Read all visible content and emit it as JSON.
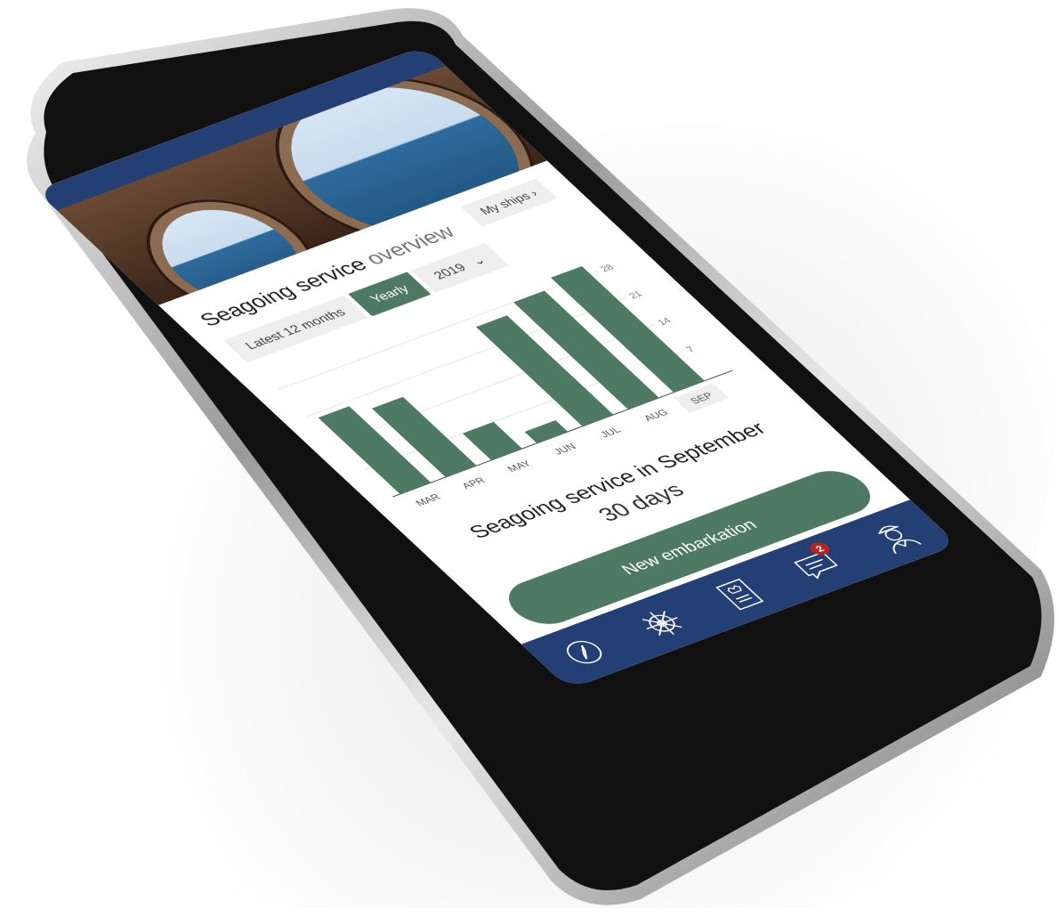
{
  "overview": {
    "title_strong": "Seagoing service",
    "title_light": "overview",
    "my_ships_label": "My ships",
    "chevron": "›"
  },
  "filters": {
    "latest_label": "Latest 12 months",
    "yearly_label": "Yearly",
    "year_value": "2019",
    "dropdown_glyph": "⌄"
  },
  "chart_data": {
    "type": "bar",
    "categories": [
      "MAR",
      "APR",
      "MAY",
      "JUN",
      "JUL",
      "AUG",
      "SEP"
    ],
    "values": [
      20,
      18,
      7,
      3,
      26,
      28,
      30
    ],
    "yticks": [
      "28",
      "21",
      "14",
      "7"
    ],
    "ylim": [
      0,
      30
    ],
    "highlight": "SEP",
    "colors": {
      "bar": "#4e7a63",
      "highlight_bg": "#eeeeee",
      "grid": "#dddddd"
    }
  },
  "summary": {
    "label": "Seagoing service in September",
    "value": "30 days"
  },
  "cta": {
    "label": "New embarkation"
  },
  "tabbar": {
    "items": [
      {
        "name": "compass-icon"
      },
      {
        "name": "ship-wheel-icon"
      },
      {
        "name": "certificate-book-icon"
      },
      {
        "name": "messages-icon",
        "badge": "2"
      },
      {
        "name": "sailor-profile-icon"
      }
    ],
    "color": "#243f73"
  }
}
